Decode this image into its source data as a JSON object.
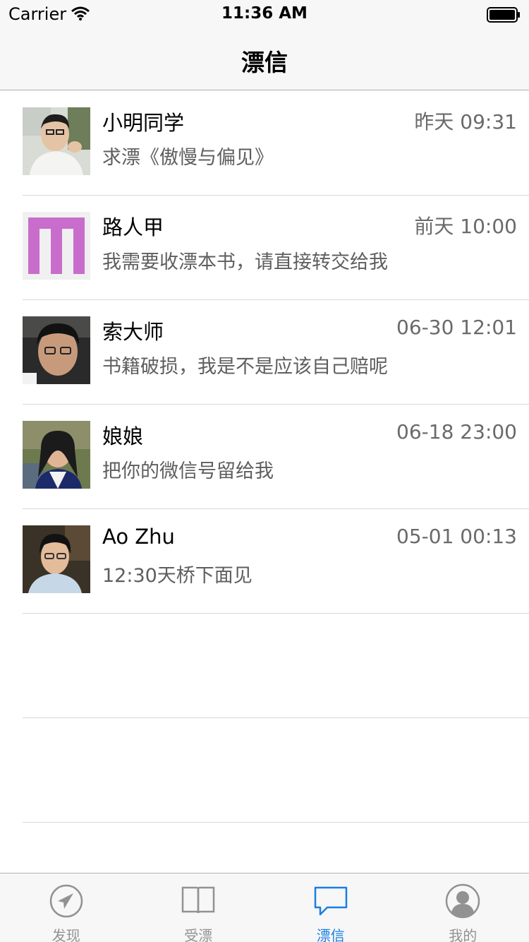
{
  "status_bar": {
    "carrier": "Carrier",
    "time": "11:36 AM"
  },
  "nav": {
    "title": "漂信"
  },
  "messages": [
    {
      "name": "小明同学",
      "time": "昨天 09:31",
      "message": "求漂《傲慢与偏见》",
      "avatar": "photo-avatar"
    },
    {
      "name": "路人甲",
      "time": "前天 10:00",
      "message": "我需要收漂本书，请直接转交给我",
      "avatar": "pattern-avatar"
    },
    {
      "name": "索大师",
      "time": "06-30 12:01",
      "message": "书籍破损，我是不是应该自己赔呢",
      "avatar": "photo-avatar"
    },
    {
      "name": "娘娘",
      "time": "06-18 23:00",
      "message": "把你的微信号留给我",
      "avatar": "photo-avatar"
    },
    {
      "name": "Ao Zhu",
      "time": "05-01 00:13",
      "message": "12:30天桥下面见",
      "avatar": "photo-avatar"
    }
  ],
  "tabs": [
    {
      "label": "发现",
      "icon": "compass-icon",
      "active": false
    },
    {
      "label": "受漂",
      "icon": "book-icon",
      "active": false
    },
    {
      "label": "漂信",
      "icon": "chat-bubble-icon",
      "active": true
    },
    {
      "label": "我的",
      "icon": "profile-icon",
      "active": false
    }
  ],
  "colors": {
    "accent": "#1a7fe0",
    "tab_inactive": "#929292",
    "pattern_avatar": "#c86dcc"
  }
}
